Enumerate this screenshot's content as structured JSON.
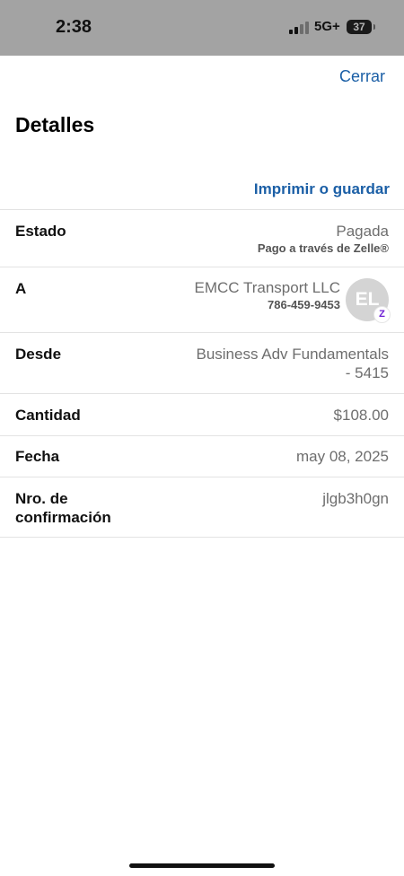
{
  "status_bar": {
    "time": "2:38",
    "network": "5G+",
    "battery": "37"
  },
  "header": {
    "close_label": "Cerrar",
    "title": "Detalles",
    "print_label": "Imprimir o guardar"
  },
  "details": {
    "status": {
      "label": "Estado",
      "value": "Pagada",
      "sub": "Pago a través de Zelle®"
    },
    "recipient": {
      "label": "A",
      "name": "EMCC Transport LLC",
      "phone": "786-459-9453",
      "initials": "EL",
      "badge": "Z"
    },
    "from": {
      "label": "Desde",
      "value_line1": "Business Adv Fundamentals",
      "value_line2": "- 5415"
    },
    "amount": {
      "label": "Cantidad",
      "value": "$108.00"
    },
    "date": {
      "label": "Fecha",
      "value": "may 08, 2025"
    },
    "confirmation": {
      "label_line1": "Nro. de",
      "label_line2": "confirmación",
      "value": "jlgb3h0gn"
    }
  },
  "colors": {
    "link": "#1b5fa6",
    "zelle_purple": "#6d1ed4",
    "status_bar": "#a3a3a3"
  }
}
